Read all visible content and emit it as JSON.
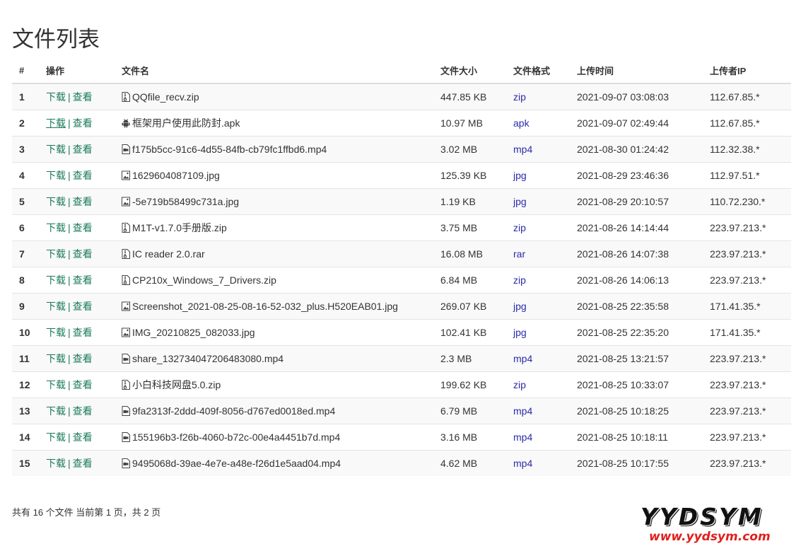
{
  "page_title": "文件列表",
  "columns": {
    "index": "#",
    "actions": "操作",
    "name": "文件名",
    "size": "文件大小",
    "format": "文件格式",
    "time": "上传时间",
    "ip": "上传者IP"
  },
  "actions": {
    "download": "下载",
    "separator": "|",
    "view": "查看"
  },
  "files": [
    {
      "index": "1",
      "icon": "zip",
      "name": "QQfile_recv.zip",
      "size": "447.85 KB",
      "format": "zip",
      "time": "2021-09-07 03:08:03",
      "ip": "112.67.85.*"
    },
    {
      "index": "2",
      "icon": "apk",
      "name": "框架用户使用此防封.apk",
      "size": "10.97 MB",
      "format": "apk",
      "time": "2021-09-07 02:49:44",
      "ip": "112.67.85.*"
    },
    {
      "index": "3",
      "icon": "video",
      "name": "f175b5cc-91c6-4d55-84fb-cb79fc1ffbd6.mp4",
      "size": "3.02 MB",
      "format": "mp4",
      "time": "2021-08-30 01:24:42",
      "ip": "112.32.38.*"
    },
    {
      "index": "4",
      "icon": "image",
      "name": "1629604087109.jpg",
      "size": "125.39 KB",
      "format": "jpg",
      "time": "2021-08-29 23:46:36",
      "ip": "112.97.51.*"
    },
    {
      "index": "5",
      "icon": "image",
      "name": "-5e719b58499c731a.jpg",
      "size": "1.19 KB",
      "format": "jpg",
      "time": "2021-08-29 20:10:57",
      "ip": "110.72.230.*"
    },
    {
      "index": "6",
      "icon": "zip",
      "name": "M1T-v1.7.0手册版.zip",
      "size": "3.75 MB",
      "format": "zip",
      "time": "2021-08-26 14:14:44",
      "ip": "223.97.213.*"
    },
    {
      "index": "7",
      "icon": "zip",
      "name": "IC reader 2.0.rar",
      "size": "16.08 MB",
      "format": "rar",
      "time": "2021-08-26 14:07:38",
      "ip": "223.97.213.*"
    },
    {
      "index": "8",
      "icon": "zip",
      "name": "CP210x_Windows_7_Drivers.zip",
      "size": "6.84 MB",
      "format": "zip",
      "time": "2021-08-26 14:06:13",
      "ip": "223.97.213.*"
    },
    {
      "index": "9",
      "icon": "image",
      "name": "Screenshot_2021-08-25-08-16-52-032_plus.H520EAB01.jpg",
      "size": "269.07 KB",
      "format": "jpg",
      "time": "2021-08-25 22:35:58",
      "ip": "171.41.35.*"
    },
    {
      "index": "10",
      "icon": "image",
      "name": "IMG_20210825_082033.jpg",
      "size": "102.41 KB",
      "format": "jpg",
      "time": "2021-08-25 22:35:20",
      "ip": "171.41.35.*"
    },
    {
      "index": "11",
      "icon": "video",
      "name": "share_132734047206483080.mp4",
      "size": "2.3 MB",
      "format": "mp4",
      "time": "2021-08-25 13:21:57",
      "ip": "223.97.213.*"
    },
    {
      "index": "12",
      "icon": "zip",
      "name": "小白科技网盘5.0.zip",
      "size": "199.62 KB",
      "format": "zip",
      "time": "2021-08-25 10:33:07",
      "ip": "223.97.213.*"
    },
    {
      "index": "13",
      "icon": "video",
      "name": "9fa2313f-2ddd-409f-8056-d767ed0018ed.mp4",
      "size": "6.79 MB",
      "format": "mp4",
      "time": "2021-08-25 10:18:25",
      "ip": "223.97.213.*"
    },
    {
      "index": "14",
      "icon": "video",
      "name": "155196b3-f26b-4060-b72c-00e4a4451b7d.mp4",
      "size": "3.16 MB",
      "format": "mp4",
      "time": "2021-08-25 10:18:11",
      "ip": "223.97.213.*"
    },
    {
      "index": "15",
      "icon": "video",
      "name": "9495068d-39ae-4e7e-a48e-f26d1e5aad04.mp4",
      "size": "4.62 MB",
      "format": "mp4",
      "time": "2021-08-25 10:17:55",
      "ip": "223.97.213.*"
    }
  ],
  "footer": {
    "info": "共有 16 个文件  当前第 1 页，共 2 页"
  },
  "watermark": {
    "mark": "YYDSYM",
    "url": "www.yydsym.com"
  },
  "colors": {
    "action_link": "#1a7a5a",
    "format_link": "#2a2aaa",
    "watermark_url": "#e0201c"
  }
}
